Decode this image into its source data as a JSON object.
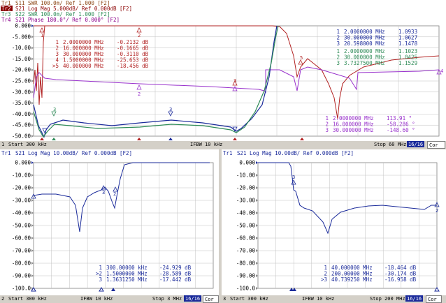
{
  "top": {
    "traces": [
      {
        "id": "Tr1",
        "label": "S11  SWR 100.0m/ Ref 1.000 [F2]",
        "color": "#8b4513",
        "active": false
      },
      {
        "id": "Tr2",
        "label": "S21  Log Mag 5.000dB/ Ref 0.000dB [F2]",
        "color": "#8b0000",
        "active": true
      },
      {
        "id": "Tr3",
        "label": "S22  SWR 100.0m/ Ref 1.000 [F2]",
        "color": "#2e8b57",
        "active": false
      },
      {
        "id": "Tr4",
        "label": "S21  Phase 180.0°/ Ref 0.000° [F2]",
        "color": "#8b008b",
        "active": false
      }
    ],
    "y_ticks": [
      "0.000",
      "-5.000",
      "-10.00",
      "-15.00",
      "-20.00",
      "-25.00",
      "-30.00",
      "-35.00",
      "-40.00",
      "-45.00",
      "-50.00"
    ],
    "markers_red": [
      {
        "n": "1",
        "freq": "2.0000000 MHz",
        "val": "-0.2132 dB"
      },
      {
        "n": "2",
        "freq": "16.000000 MHz",
        "val": "-0.1665 dB"
      },
      {
        "n": "3",
        "freq": "30.000000 MHz",
        "val": "-0.3110 dB"
      },
      {
        "n": "4",
        "freq": "1.5000000 MHz",
        "val": "-25.653 dB"
      },
      {
        "n": ">5",
        "freq": "40.000000 MHz",
        "val": "-18.456 dB"
      }
    ],
    "markers_blue": [
      {
        "n": "1",
        "freq": "2.0000000 MHz",
        "val": "1.0933"
      },
      {
        "n": "2",
        "freq": "30.000000 MHz",
        "val": "1.0627"
      },
      {
        "n": "3",
        "freq": "20.598000 MHz",
        "val": "1.1478"
      }
    ],
    "markers_green": [
      {
        "n": "1",
        "freq": "2.0000000 MHz",
        "val": "1.1023"
      },
      {
        "n": "2",
        "freq": "30.000000 MHz",
        "val": "1.0425"
      },
      {
        "n": "3",
        "freq": "3.7327500 MHz",
        "val": "1.1529"
      }
    ],
    "markers_purple": [
      {
        "n": "1",
        "freq": "2.0000000 MHz",
        "val": "113.91 °"
      },
      {
        "n": "2",
        "freq": "16.000000 MHz",
        "val": "-58.286 °"
      },
      {
        "n": "3",
        "freq": "30.000000 MHz",
        "val": "-148.60 °"
      }
    ],
    "status": {
      "ch": "1",
      "start": "Start 300 kHz",
      "ifbw": "IFBW 10 kHz",
      "stop": "Stop 60 MHz",
      "points": "16/16",
      "cor": "Cor"
    }
  },
  "bottom_left": {
    "trace": {
      "id": "Tr1",
      "label": "S21  Log Mag 10.00dB/ Ref 0.000dB [F2]"
    },
    "y_ticks": [
      "0.000",
      "-10.00",
      "-20.00",
      "-30.00",
      "-40.00",
      "-50.00",
      "-60.00",
      "-70.00",
      "-80.00",
      "-90.00",
      "-100.0"
    ],
    "markers": [
      {
        "n": "1",
        "freq": "300.00000 kHz",
        "val": "-24.929 dB"
      },
      {
        "n": ">2",
        "freq": "1.5000000 MHz",
        "val": "-28.589 dB"
      },
      {
        "n": "3",
        "freq": "1.3631250 MHz",
        "val": "-17.442 dB"
      }
    ],
    "status": {
      "ch": "2",
      "start": "Start 300 kHz",
      "ifbw": "IFBW 10 kHz",
      "stop": "Stop 3 MHz",
      "points": "16/16",
      "cor": "Cor"
    }
  },
  "bottom_right": {
    "trace": {
      "id": "Tr1",
      "label": "S21  Log Mag 10.00dB/ Ref 0.000dB [F2]"
    },
    "y_ticks": [
      "0.000",
      "-10.00",
      "-20.00",
      "-30.00",
      "-40.00",
      "-50.00",
      "-60.00",
      "-70.00",
      "-80.00",
      "-90.00",
      "-100.0"
    ],
    "markers": [
      {
        "n": "1",
        "freq": "40.000000 MHz",
        "val": "-18.464 dB"
      },
      {
        "n": "2",
        "freq": "200.00000 MHz",
        "val": "-30.174 dB"
      },
      {
        "n": ">3",
        "freq": "40.739250 MHz",
        "val": "-16.958 dB"
      }
    ],
    "status": {
      "ch": "3",
      "start": "Start 300 kHz",
      "ifbw": "IFBW 10 kHz",
      "stop": "Stop 200 MHz",
      "points": "16/16",
      "cor": "Cor"
    }
  },
  "colors": {
    "grid": "#c0c0c0",
    "blue": "#1a2a9a",
    "red": "#b22222",
    "green": "#2e8b57",
    "purple": "#9932cc",
    "brown": "#8b4513"
  }
}
